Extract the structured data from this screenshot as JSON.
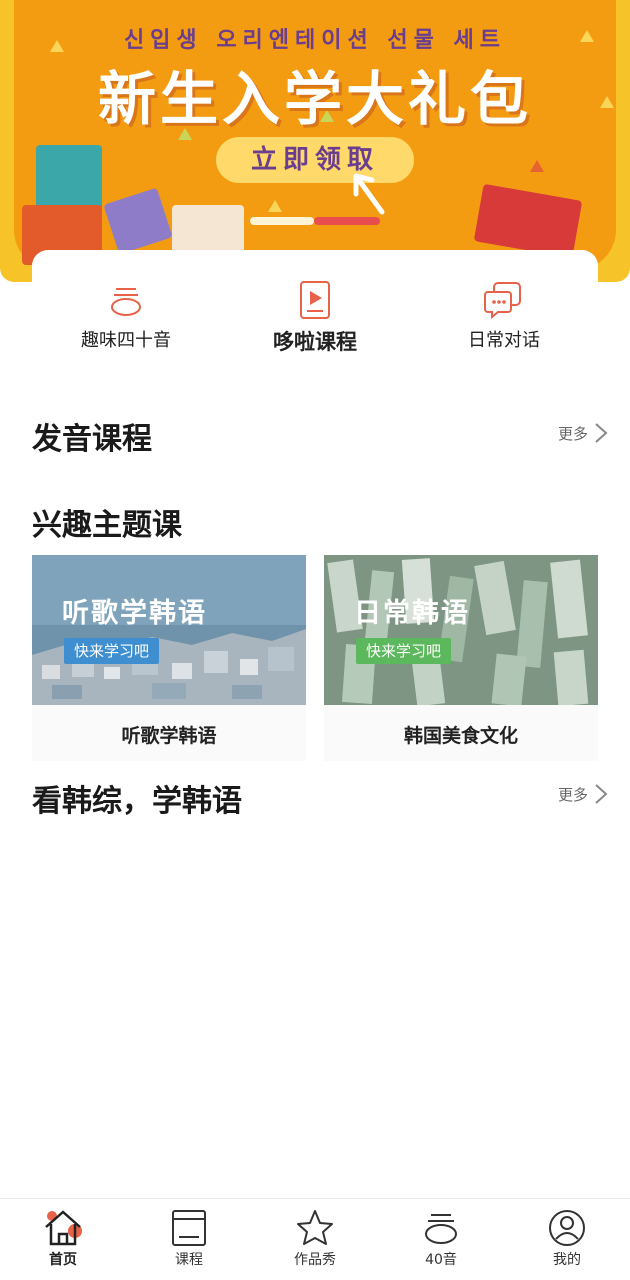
{
  "banner": {
    "subtitle": "신입생 오리엔테이션 선물 세트",
    "title": "新生入学大礼包",
    "button": "立即领取",
    "slide_index": 2,
    "slide_count": 2
  },
  "shortcuts": [
    {
      "label": "趣味四十音",
      "icon": "forty-sounds-icon"
    },
    {
      "label": "哆啦课程",
      "icon": "video-course-icon"
    },
    {
      "label": "日常对话",
      "icon": "chat-bubbles-icon"
    }
  ],
  "sections": {
    "pronunciation": {
      "title": "发音课程",
      "more": "更多"
    },
    "interest": {
      "title": "兴趣主题课"
    },
    "variety": {
      "title": "看韩综，学韩语",
      "more": "更多"
    }
  },
  "cards": [
    {
      "image_title": "听歌学韩语",
      "image_tag": "快来学习吧",
      "caption": "听歌学韩语"
    },
    {
      "image_title": "日常韩语",
      "image_tag": "快来学习吧",
      "caption": "韩国美食文化"
    }
  ],
  "bottom_nav": [
    {
      "label": "首页",
      "icon": "home-icon",
      "active": true
    },
    {
      "label": "课程",
      "icon": "book-icon",
      "active": false
    },
    {
      "label": "作品秀",
      "icon": "star-icon",
      "active": false
    },
    {
      "label": "40音",
      "icon": "forty-sounds-icon",
      "active": false
    },
    {
      "label": "我的",
      "icon": "profile-icon",
      "active": false
    }
  ],
  "colors": {
    "accent": "#e8624a",
    "banner_bg": "#f39c12",
    "banner_outer": "#f6c329",
    "tag_blue": "#3e8ed0",
    "tag_green": "#5cb85c"
  }
}
